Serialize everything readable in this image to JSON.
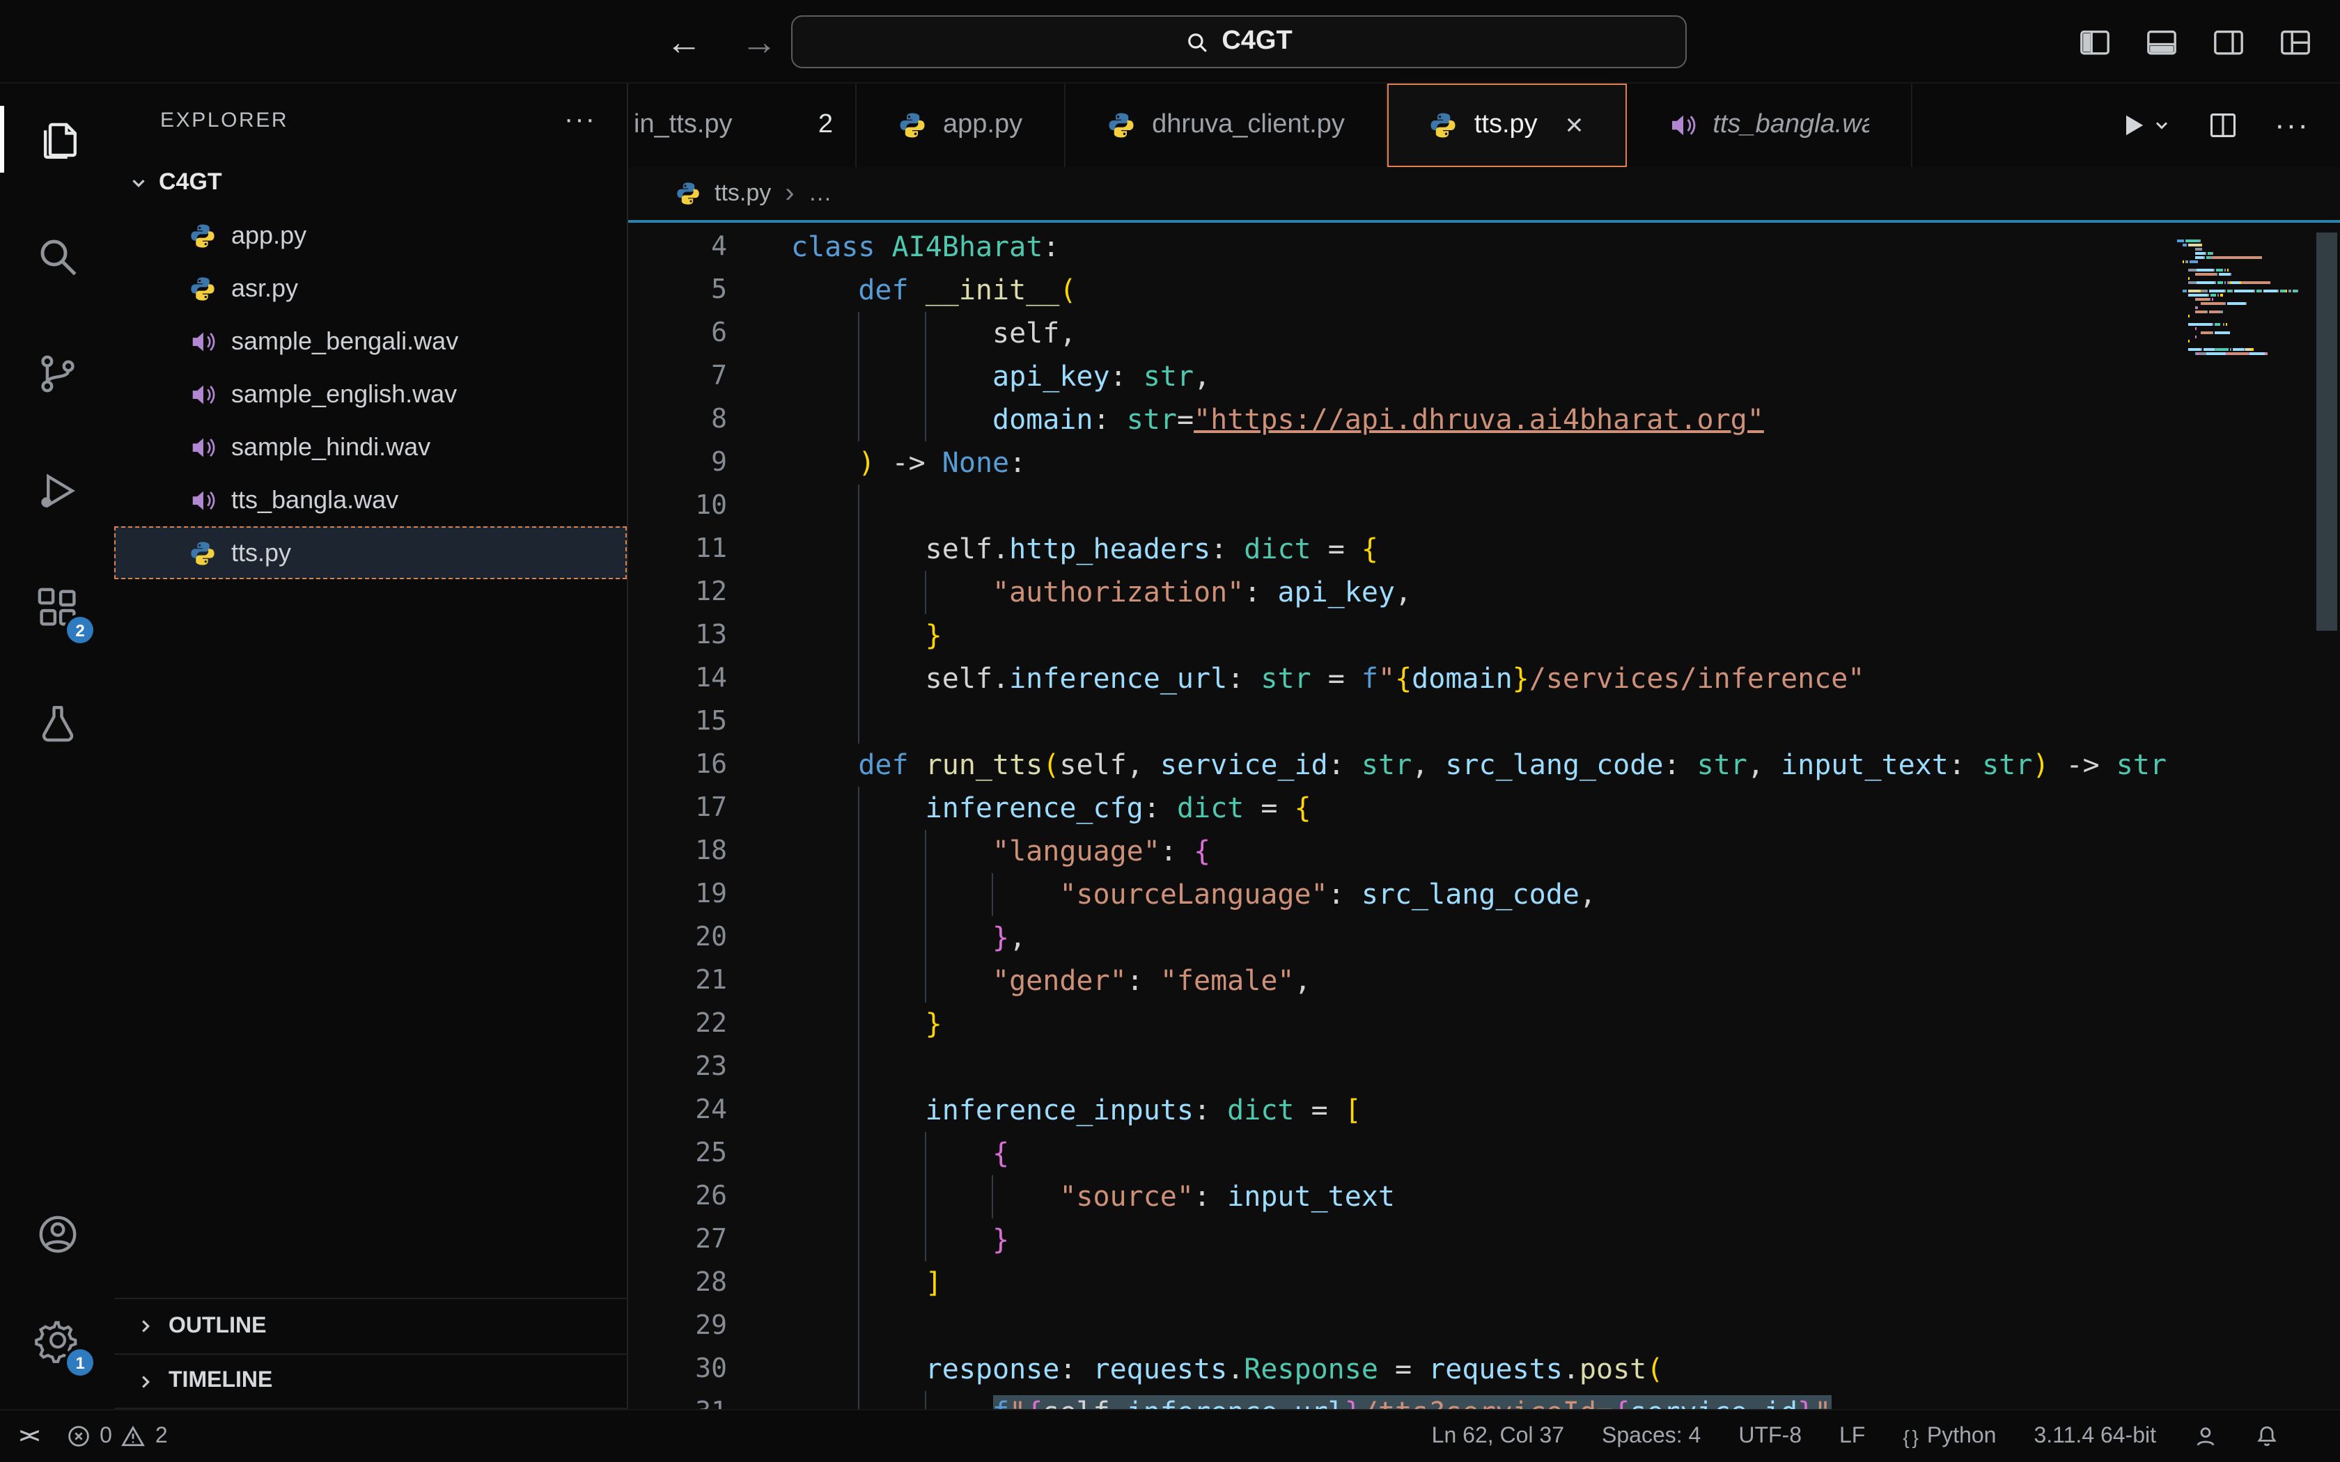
{
  "glyphs": {
    "more_h": "···",
    "ellipsis": "…",
    "chevron": "›",
    "close": "×",
    "remote": "><",
    "back": "←",
    "forward": "→"
  },
  "title_bar": {
    "search_value": "C4GT",
    "back_icon": "←",
    "forward_icon": "→"
  },
  "activity_bar": {
    "icons": [
      "explorer",
      "search",
      "source-control",
      "run-debug",
      "extensions",
      "testing",
      "account",
      "settings"
    ],
    "extensions_badge": "2",
    "settings_badge": "1"
  },
  "sidebar": {
    "title": "EXPLORER",
    "folder": "C4GT",
    "files": [
      {
        "name": "app.py",
        "icon": "python"
      },
      {
        "name": "asr.py",
        "icon": "python"
      },
      {
        "name": "sample_bengali.wav",
        "icon": "audio"
      },
      {
        "name": "sample_english.wav",
        "icon": "audio"
      },
      {
        "name": "sample_hindi.wav",
        "icon": "audio"
      },
      {
        "name": "tts_bangla.wav",
        "icon": "audio"
      },
      {
        "name": "tts.py",
        "icon": "python",
        "selected": true
      }
    ],
    "sections": [
      {
        "label": "OUTLINE"
      },
      {
        "label": "TIMELINE"
      }
    ]
  },
  "tab_bar": {
    "tabs": [
      {
        "label": "in_tts.py",
        "badge": "2",
        "partial": true
      },
      {
        "label": "app.py",
        "icon": "python"
      },
      {
        "label": "dhruva_client.py",
        "icon": "python"
      },
      {
        "label": "tts.py",
        "icon": "python",
        "active": true
      },
      {
        "label": "tts_bangla.wav",
        "icon": "audio",
        "preview": true
      }
    ]
  },
  "breadcrumb": {
    "file": "tts.py",
    "separator": "›",
    "rest": "…"
  },
  "editor": {
    "first_line": 4,
    "lines": [
      {
        "n": 4,
        "parts": [
          [
            "kw",
            "class"
          ],
          [
            "pl",
            " "
          ],
          [
            "ty",
            "AI4Bharat"
          ],
          [
            "pl",
            ":"
          ]
        ]
      },
      {
        "n": 5,
        "parts": [
          [
            "pl",
            "    "
          ],
          [
            "kw",
            "def"
          ],
          [
            "pl",
            " "
          ],
          [
            "fn",
            "__init__"
          ],
          [
            "b1",
            "("
          ]
        ]
      },
      {
        "n": 6,
        "parts": [
          [
            "pl",
            "            self,"
          ]
        ]
      },
      {
        "n": 7,
        "parts": [
          [
            "pl",
            "            "
          ],
          [
            "va",
            "api_key"
          ],
          [
            "pl",
            ": "
          ],
          [
            "ty",
            "str"
          ],
          [
            "pl",
            ","
          ]
        ]
      },
      {
        "n": 8,
        "parts": [
          [
            "pl",
            "            "
          ],
          [
            "va",
            "domain"
          ],
          [
            "pl",
            ": "
          ],
          [
            "ty",
            "str"
          ],
          [
            "pl",
            "="
          ],
          [
            "sl",
            "\"https://api.dhruva.ai4bharat.org\""
          ]
        ]
      },
      {
        "n": 9,
        "parts": [
          [
            "pl",
            "    "
          ],
          [
            "b1",
            ")"
          ],
          [
            "pl",
            " -> "
          ],
          [
            "kw",
            "None"
          ],
          [
            "pl",
            ":"
          ]
        ]
      },
      {
        "n": 10,
        "parts": []
      },
      {
        "n": 11,
        "parts": [
          [
            "pl",
            "        self."
          ],
          [
            "va",
            "http_headers"
          ],
          [
            "pl",
            ": "
          ],
          [
            "ty",
            "dict"
          ],
          [
            "pl",
            " = "
          ],
          [
            "b1",
            "{"
          ]
        ]
      },
      {
        "n": 12,
        "parts": [
          [
            "pl",
            "            "
          ],
          [
            "st",
            "\"authorization\""
          ],
          [
            "pl",
            ": "
          ],
          [
            "va",
            "api_key"
          ],
          [
            "pl",
            ","
          ]
        ]
      },
      {
        "n": 13,
        "parts": [
          [
            "pl",
            "        "
          ],
          [
            "b1",
            "}"
          ]
        ]
      },
      {
        "n": 14,
        "parts": [
          [
            "pl",
            "        self."
          ],
          [
            "va",
            "inference_url"
          ],
          [
            "pl",
            ": "
          ],
          [
            "ty",
            "str"
          ],
          [
            "pl",
            " = "
          ],
          [
            "kw",
            "f"
          ],
          [
            "st",
            "\""
          ],
          [
            "b1",
            "{"
          ],
          [
            "va",
            "domain"
          ],
          [
            "b1",
            "}"
          ],
          [
            "st",
            "/services/inference\""
          ]
        ]
      },
      {
        "n": 15,
        "parts": []
      },
      {
        "n": 16,
        "parts": [
          [
            "pl",
            "    "
          ],
          [
            "kw",
            "def"
          ],
          [
            "pl",
            " "
          ],
          [
            "fn",
            "run_tts"
          ],
          [
            "b1",
            "("
          ],
          [
            "pl",
            "self, "
          ],
          [
            "va",
            "service_id"
          ],
          [
            "pl",
            ": "
          ],
          [
            "ty",
            "str"
          ],
          [
            "pl",
            ", "
          ],
          [
            "va",
            "src_lang_code"
          ],
          [
            "pl",
            ": "
          ],
          [
            "ty",
            "str"
          ],
          [
            "pl",
            ", "
          ],
          [
            "va",
            "input_text"
          ],
          [
            "pl",
            ": "
          ],
          [
            "ty",
            "str"
          ],
          [
            "b1",
            ")"
          ],
          [
            "pl",
            " -> "
          ],
          [
            "ty",
            "str"
          ],
          [
            "pl",
            ":"
          ]
        ]
      },
      {
        "n": 17,
        "parts": [
          [
            "pl",
            "        "
          ],
          [
            "va",
            "inference_cfg"
          ],
          [
            "pl",
            ": "
          ],
          [
            "ty",
            "dict"
          ],
          [
            "pl",
            " = "
          ],
          [
            "b1",
            "{"
          ]
        ]
      },
      {
        "n": 18,
        "parts": [
          [
            "pl",
            "            "
          ],
          [
            "st",
            "\"language\""
          ],
          [
            "pl",
            ": "
          ],
          [
            "b2",
            "{"
          ]
        ]
      },
      {
        "n": 19,
        "parts": [
          [
            "pl",
            "                "
          ],
          [
            "st",
            "\"sourceLanguage\""
          ],
          [
            "pl",
            ": "
          ],
          [
            "va",
            "src_lang_code"
          ],
          [
            "pl",
            ","
          ]
        ]
      },
      {
        "n": 20,
        "parts": [
          [
            "pl",
            "            "
          ],
          [
            "b2",
            "}"
          ],
          [
            "pl",
            ","
          ]
        ]
      },
      {
        "n": 21,
        "parts": [
          [
            "pl",
            "            "
          ],
          [
            "st",
            "\"gender\""
          ],
          [
            "pl",
            ": "
          ],
          [
            "st",
            "\"female\""
          ],
          [
            "pl",
            ","
          ]
        ]
      },
      {
        "n": 22,
        "parts": [
          [
            "pl",
            "        "
          ],
          [
            "b1",
            "}"
          ]
        ]
      },
      {
        "n": 23,
        "parts": []
      },
      {
        "n": 24,
        "parts": [
          [
            "pl",
            "        "
          ],
          [
            "va",
            "inference_inputs"
          ],
          [
            "pl",
            ": "
          ],
          [
            "ty",
            "dict"
          ],
          [
            "pl",
            " = "
          ],
          [
            "b1",
            "["
          ]
        ]
      },
      {
        "n": 25,
        "parts": [
          [
            "pl",
            "            "
          ],
          [
            "b2",
            "{"
          ]
        ]
      },
      {
        "n": 26,
        "parts": [
          [
            "pl",
            "                "
          ],
          [
            "st",
            "\"source\""
          ],
          [
            "pl",
            ": "
          ],
          [
            "va",
            "input_text"
          ]
        ]
      },
      {
        "n": 27,
        "parts": [
          [
            "pl",
            "            "
          ],
          [
            "b2",
            "}"
          ]
        ]
      },
      {
        "n": 28,
        "parts": [
          [
            "pl",
            "        "
          ],
          [
            "b1",
            "]"
          ]
        ]
      },
      {
        "n": 29,
        "parts": []
      },
      {
        "n": 30,
        "parts": [
          [
            "pl",
            "        "
          ],
          [
            "va",
            "response"
          ],
          [
            "pl",
            ": "
          ],
          [
            "va",
            "requests"
          ],
          [
            "pl",
            "."
          ],
          [
            "ty",
            "Response"
          ],
          [
            "pl",
            " = "
          ],
          [
            "va",
            "requests"
          ],
          [
            "pl",
            "."
          ],
          [
            "fn",
            "post"
          ],
          [
            "b1",
            "("
          ]
        ]
      },
      {
        "n": 31,
        "sel": true,
        "parts": [
          [
            "pl",
            "            "
          ],
          [
            "kw",
            "f"
          ],
          [
            "st",
            "\""
          ],
          [
            "b2",
            "{"
          ],
          [
            "pl",
            "self."
          ],
          [
            "va",
            "inference_url"
          ],
          [
            "b2",
            "}"
          ],
          [
            "st",
            "/tts?serviceId="
          ],
          [
            "b2",
            "{"
          ],
          [
            "va",
            "service_id"
          ],
          [
            "b2",
            "}"
          ],
          [
            "st",
            "\""
          ]
        ]
      }
    ]
  },
  "status_bar": {
    "remote_indicator": "><",
    "problems": {
      "errors": "0",
      "warnings": "2"
    },
    "items": [
      {
        "id": "cursor-position",
        "label": "Ln 62, Col 37"
      },
      {
        "id": "indentation",
        "label": "Spaces: 4"
      },
      {
        "id": "encoding",
        "label": "UTF-8"
      },
      {
        "id": "eol",
        "label": "LF"
      },
      {
        "id": "language-mode",
        "label": "Python",
        "icon": "braces"
      },
      {
        "id": "python-interpreter",
        "label": "3.11.4 64-bit"
      },
      {
        "id": "feedback",
        "icon": "person"
      },
      {
        "id": "notifications",
        "icon": "bell"
      }
    ]
  }
}
